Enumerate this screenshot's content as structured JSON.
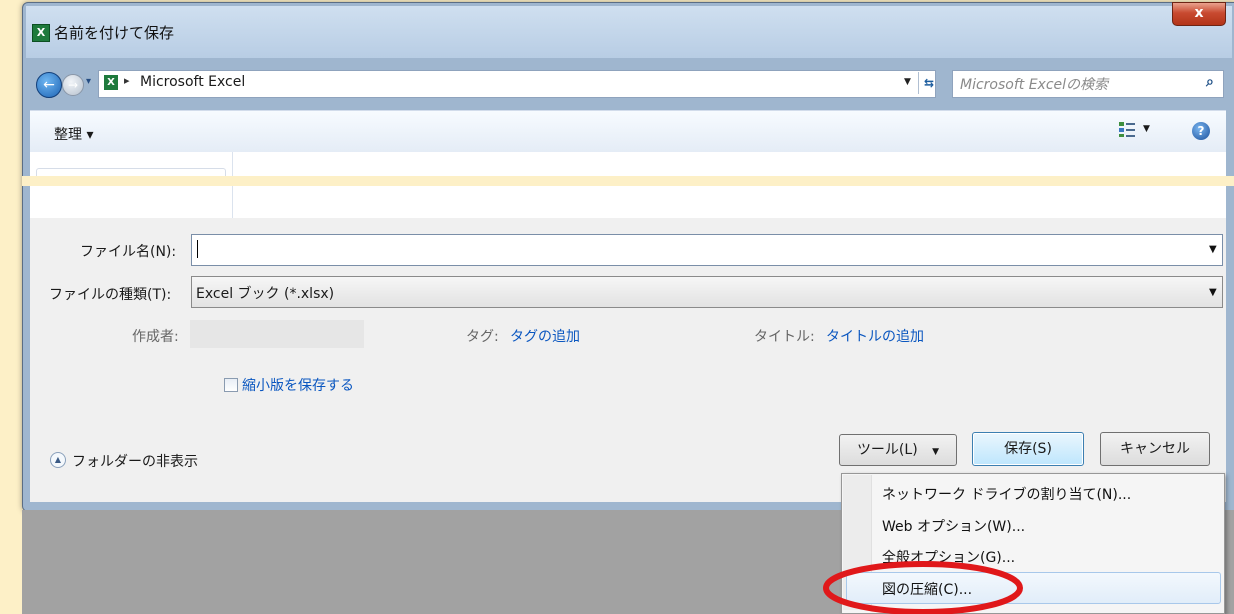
{
  "window": {
    "title": "名前を付けて保存",
    "app_icon": "excel-icon",
    "close_label": "x"
  },
  "address": {
    "location": "Microsoft Excel",
    "back_glyph": "←",
    "forward_glyph": "→",
    "recent_glyph": "▾",
    "sep_glyph": "▸",
    "drop_glyph": "▼",
    "refresh_glyph": "⇆"
  },
  "search": {
    "placeholder": "Microsoft Excelの検索",
    "icon_glyph": "⌕"
  },
  "toolbar": {
    "organize": "整理 ▾",
    "view_drop": "▼",
    "help": "?"
  },
  "form": {
    "filename_label": "ファイル名(N):",
    "filename_value": "",
    "filetype_label": "ファイルの種類(T):",
    "filetype_value": "Excel ブック (*.xlsx)",
    "author_label": "作成者:",
    "tags_label": "タグ:",
    "tags_link": "タグの追加",
    "title_label": "タイトル:",
    "title_link": "タイトルの追加",
    "thumbnail_label": "縮小版を保存する",
    "hide_folders": "フォルダーの非表示",
    "dd_glyph": "▼"
  },
  "buttons": {
    "tools": "ツール(L)",
    "tools_drop": "▼",
    "save": "保存(S)",
    "cancel": "キャンセル"
  },
  "tools_menu": {
    "items": [
      "ネットワーク ドライブの割り当て(N)...",
      "Web オプション(W)...",
      "全般オプション(G)...",
      "図の圧縮(C)..."
    ],
    "highlighted_index": 3,
    "annotation_color": "#e0181a"
  },
  "colors": {
    "accent": "#0b57c0",
    "window_frame": "#9fb6cf",
    "page_bg": "#fdf0c7"
  }
}
